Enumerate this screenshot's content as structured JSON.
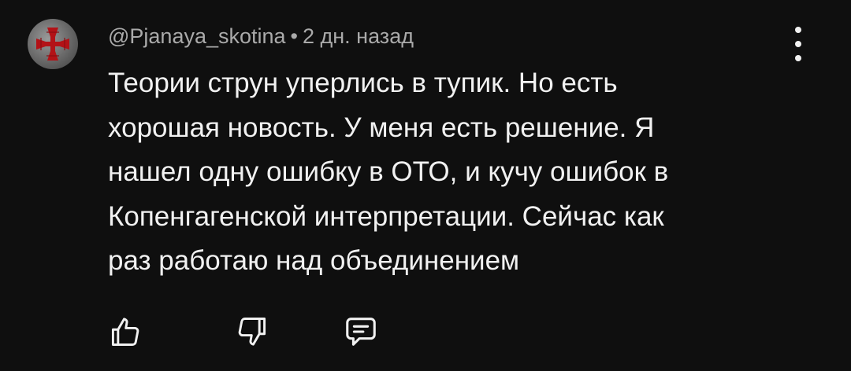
{
  "comment": {
    "author": "@Pjanaya_skotina",
    "separator": "•",
    "time": "2 дн. назад",
    "lines": [
      "Теории струн уперлись в тупик. Но есть",
      "хорошая новость. У меня есть решение. Я",
      "нашел одну ошибку в ОТО, и кучу ошибок в",
      "Копенгагенской интерпретации. Сейчас как",
      "раз работаю над объединением"
    ]
  },
  "icons": {
    "avatar": "cross-emblem-icon",
    "more": "more-vertical-icon",
    "like": "thumbs-up-icon",
    "dislike": "thumbs-down-icon",
    "reply": "reply-icon"
  },
  "colors": {
    "background": "#0f0f0f",
    "text": "#f1f1f1",
    "meta": "#aaaaaa",
    "cross": "#b31217"
  }
}
